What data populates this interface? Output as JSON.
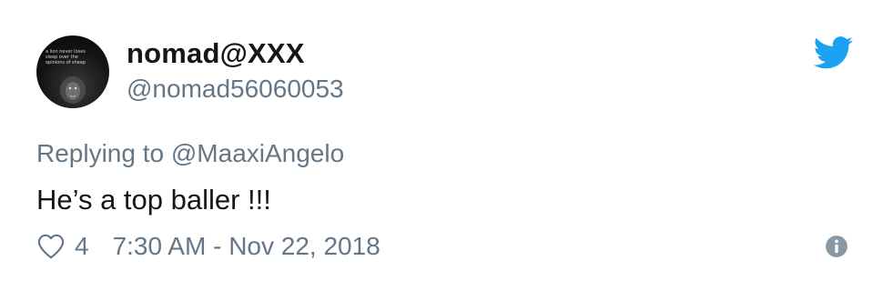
{
  "tweet": {
    "author": {
      "display_name": "nomad@XXX",
      "handle": "@nomad56060053",
      "avatar_icon": "lion-quote-avatar",
      "avatar_caption": "a lion never loses sleep over the opinions of sheep"
    },
    "reply": {
      "prefix": "Replying to ",
      "mention": "@MaaxiAngelo"
    },
    "text": "He’s a top baller !!!",
    "likes": "4",
    "timestamp": "7:30 AM - Nov 22, 2018",
    "icons": {
      "like": "heart-icon",
      "brand": "twitter-bird-icon",
      "info": "info-icon"
    }
  },
  "colors": {
    "twitter_blue": "#1da1f2",
    "text_primary": "#14171a",
    "text_secondary": "#657786",
    "info_gray": "#8899a6"
  }
}
